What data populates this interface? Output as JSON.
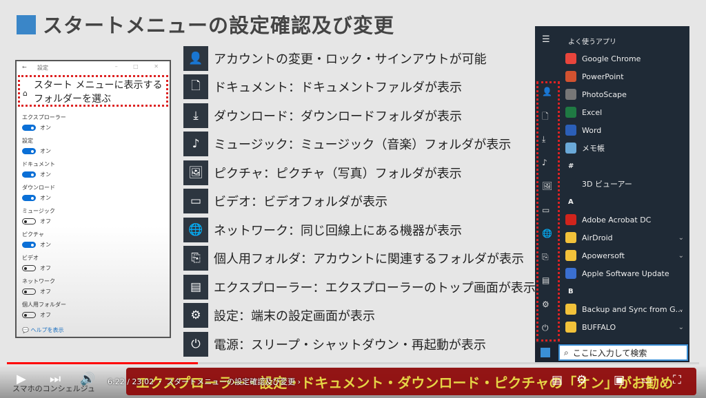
{
  "title": "スタートメニューの設定確認及び変更",
  "settings": {
    "window_title": "設定",
    "window_controls": "–  □  ✕",
    "heading": "スタート メニューに表示するフォルダーを選ぶ",
    "items": [
      {
        "label": "エクスプローラー",
        "state": "オン",
        "on": true
      },
      {
        "label": "設定",
        "state": "オン",
        "on": true
      },
      {
        "label": "ドキュメント",
        "state": "オン",
        "on": true
      },
      {
        "label": "ダウンロード",
        "state": "オン",
        "on": true
      },
      {
        "label": "ミュージック",
        "state": "オフ",
        "on": false
      },
      {
        "label": "ピクチャ",
        "state": "オン",
        "on": true
      },
      {
        "label": "ビデオ",
        "state": "オフ",
        "on": false
      },
      {
        "label": "ネットワーク",
        "state": "オフ",
        "on": false
      },
      {
        "label": "個人用フォルダー",
        "state": "オフ",
        "on": false
      }
    ],
    "help": "ヘルプを表示"
  },
  "list": [
    {
      "icon": "👤",
      "name": "account",
      "text": "アカウントの変更・ロック・サインアウトが可能"
    },
    {
      "icon": "🗋",
      "name": "document",
      "text": "ドキュメント：ドキュメントファルダが表示"
    },
    {
      "icon": "⤓",
      "name": "download",
      "text": "ダウンロード：ダウンロードフォルダが表示"
    },
    {
      "icon": "♪",
      "name": "music",
      "text": "ミュージック：ミュージック（音楽）フォルダが表示"
    },
    {
      "icon": "🖼",
      "name": "picture",
      "text": "ピクチャ：ピクチャ（写真）フォルダが表示"
    },
    {
      "icon": "▭",
      "name": "video",
      "text": "ビデオ：ビデオフォルダが表示"
    },
    {
      "icon": "🌐",
      "name": "network",
      "text": "ネットワーク：同じ回線上にある機器が表示"
    },
    {
      "icon": "⎘",
      "name": "personal-folder",
      "text": "個人用フォルダ：アカウントに関連するフォルダが表示"
    },
    {
      "icon": "▤",
      "name": "explorer",
      "text": "エクスプローラー：エクスプローラーのトップ画面が表示"
    },
    {
      "icon": "⚙",
      "name": "gear",
      "text": "設定：端末の設定画面が表示"
    },
    {
      "icon": "⏻",
      "name": "power",
      "text": "電源：スリープ・シャットダウン・再起動が表示"
    }
  ],
  "start": {
    "section_frequent": "よく使うアプリ",
    "rows": [
      {
        "type": "app",
        "label": "Google Chrome",
        "color": "#e8453c"
      },
      {
        "type": "app",
        "label": "PowerPoint",
        "color": "#d35230"
      },
      {
        "type": "app",
        "label": "PhotoScape",
        "color": "#777777"
      },
      {
        "type": "app",
        "label": "Excel",
        "color": "#1f7a43"
      },
      {
        "type": "app",
        "label": "Word",
        "color": "#2b5fb8"
      },
      {
        "type": "app",
        "label": "メモ帳",
        "color": "#6aa9d8"
      },
      {
        "type": "sect",
        "label": "#"
      },
      {
        "type": "app",
        "label": "3D ビューアー",
        "color": "#1f2a36"
      },
      {
        "type": "sect",
        "label": "A"
      },
      {
        "type": "app",
        "label": "Adobe Acrobat DC",
        "color": "#d0241c"
      },
      {
        "type": "folder",
        "label": "AirDroid",
        "color": "#f2c23a"
      },
      {
        "type": "folder",
        "label": "Apowersoft",
        "color": "#f2c23a"
      },
      {
        "type": "app",
        "label": "Apple Software Update",
        "color": "#3a6fd0"
      },
      {
        "type": "sect",
        "label": "B"
      },
      {
        "type": "folder",
        "label": "Backup and Sync from G...",
        "color": "#f2c23a"
      },
      {
        "type": "folder",
        "label": "BUFFALO",
        "color": "#f2c23a"
      }
    ],
    "search_placeholder": "ここに入力して検索"
  },
  "player": {
    "time": "6:22 / 23:02",
    "chapter": "・ スタートメニューの設定確認及び変更 ›",
    "progress_percent": 27.6,
    "brand": "スマホのコンシェルジュ",
    "banner": "エクスプローラー・設定・ドキュメント・ダウンロード・ピクチャの「オン」がお勧め"
  }
}
